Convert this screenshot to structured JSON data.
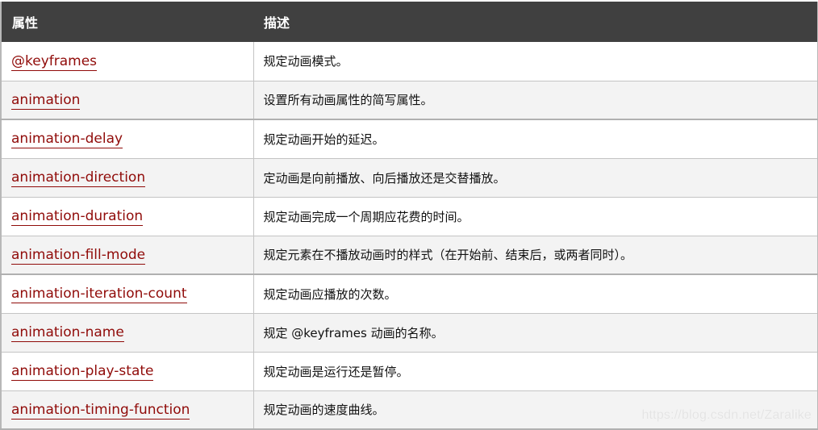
{
  "table": {
    "headers": {
      "property": "属性",
      "description": "描述"
    },
    "rows": [
      {
        "property": "@keyframes",
        "description": "规定动画模式。"
      },
      {
        "property": "animation",
        "description": "设置所有动画属性的简写属性。"
      },
      {
        "property": "animation-delay",
        "description": "规定动画开始的延迟。"
      },
      {
        "property": "animation-direction",
        "description": "定动画是向前播放、向后播放还是交替播放。"
      },
      {
        "property": "animation-duration",
        "description": "规定动画完成一个周期应花费的时间。"
      },
      {
        "property": "animation-fill-mode",
        "description": "规定元素在不播放动画时的样式（在开始前、结束后，或两者同时）。"
      },
      {
        "property": "animation-iteration-count",
        "description": "规定动画应播放的次数。"
      },
      {
        "property": "animation-name",
        "description": "规定 @keyframes 动画的名称。"
      },
      {
        "property": "animation-play-state",
        "description": "规定动画是运行还是暂停。"
      },
      {
        "property": "animation-timing-function",
        "description": "规定动画的速度曲线。"
      }
    ]
  },
  "colors": {
    "header_background": "#404040",
    "header_text": "#ffffff",
    "link": "#900b09",
    "row_alt_background": "#f3f3f3"
  },
  "watermark": "https://blog.csdn.net/Zaralike"
}
